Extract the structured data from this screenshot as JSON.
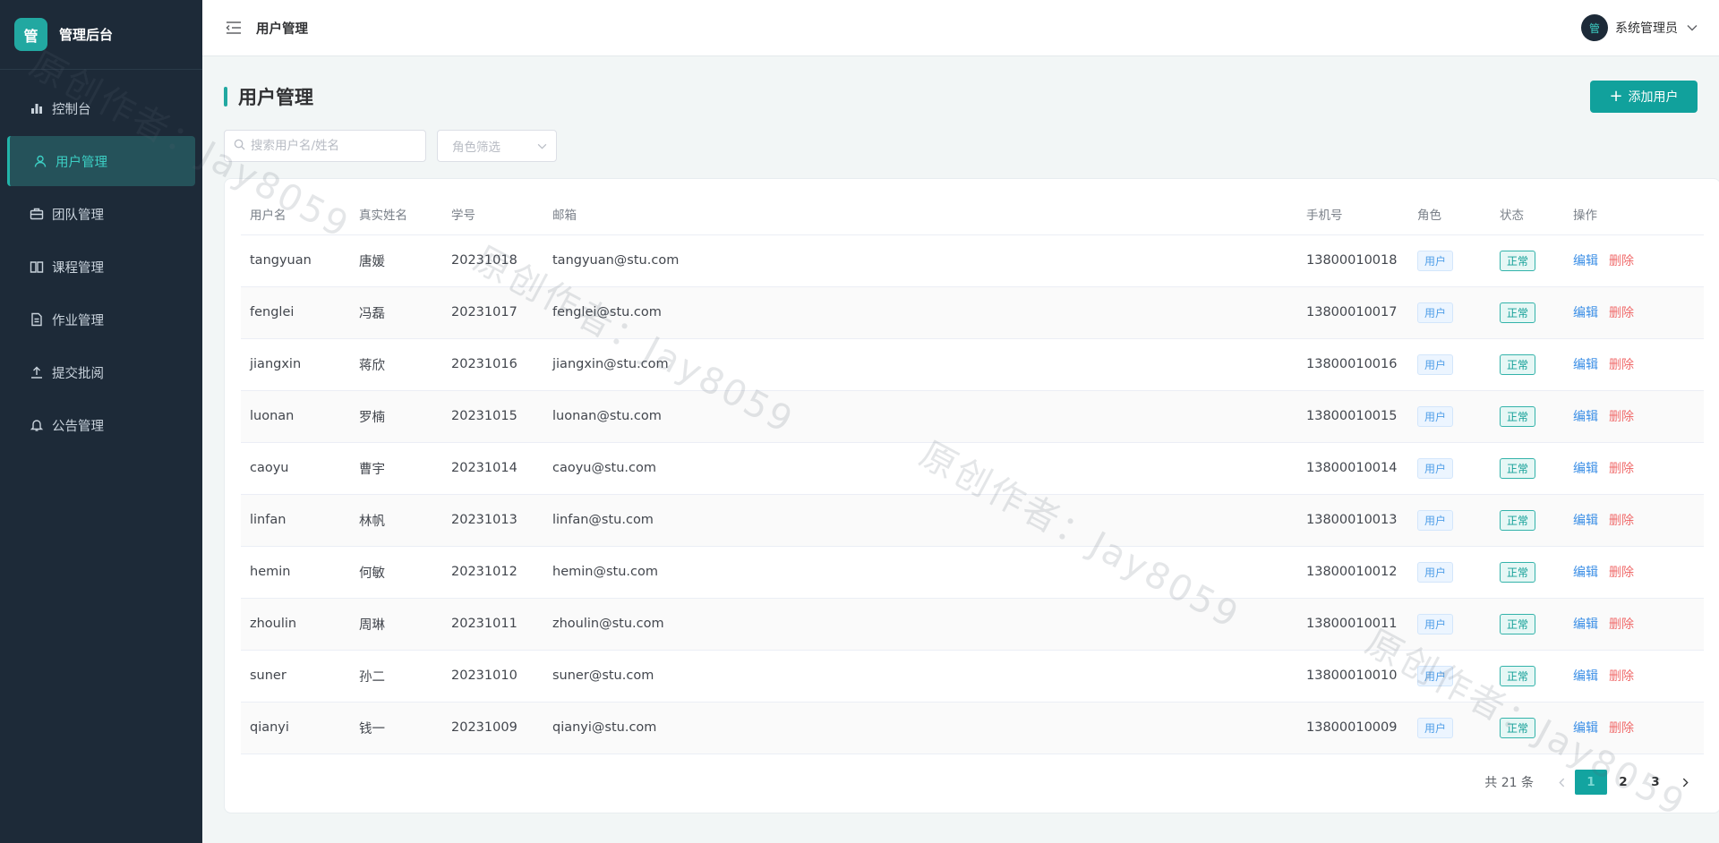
{
  "brand": {
    "logo_char": "管",
    "title": "管理后台"
  },
  "sidebar": {
    "items": [
      {
        "label": "控制台",
        "icon": "bar-chart-icon"
      },
      {
        "label": "用户管理",
        "icon": "user-icon",
        "active": true
      },
      {
        "label": "团队管理",
        "icon": "briefcase-icon"
      },
      {
        "label": "课程管理",
        "icon": "book-icon"
      },
      {
        "label": "作业管理",
        "icon": "document-icon"
      },
      {
        "label": "提交批阅",
        "icon": "upload-icon"
      },
      {
        "label": "公告管理",
        "icon": "bell-icon"
      }
    ]
  },
  "topbar": {
    "title": "用户管理",
    "avatar_char": "管",
    "user_name": "系统管理员"
  },
  "page": {
    "title": "用户管理",
    "add_button": "添加用户"
  },
  "filters": {
    "search_placeholder": "搜索用户名/姓名",
    "role_placeholder": "角色筛选"
  },
  "table": {
    "headers": {
      "username": "用户名",
      "realname": "真实姓名",
      "student_id": "学号",
      "email": "邮箱",
      "phone": "手机号",
      "role": "角色",
      "status": "状态",
      "actions": "操作"
    },
    "edit_label": "编辑",
    "delete_label": "删除",
    "rows": [
      {
        "username": "tangyuan",
        "realname": "唐媛",
        "student_id": "20231018",
        "email": "tangyuan@stu.com",
        "phone": "13800010018",
        "role": "用户",
        "status": "正常"
      },
      {
        "username": "fenglei",
        "realname": "冯磊",
        "student_id": "20231017",
        "email": "fenglei@stu.com",
        "phone": "13800010017",
        "role": "用户",
        "status": "正常"
      },
      {
        "username": "jiangxin",
        "realname": "蒋欣",
        "student_id": "20231016",
        "email": "jiangxin@stu.com",
        "phone": "13800010016",
        "role": "用户",
        "status": "正常"
      },
      {
        "username": "luonan",
        "realname": "罗楠",
        "student_id": "20231015",
        "email": "luonan@stu.com",
        "phone": "13800010015",
        "role": "用户",
        "status": "正常"
      },
      {
        "username": "caoyu",
        "realname": "曹宇",
        "student_id": "20231014",
        "email": "caoyu@stu.com",
        "phone": "13800010014",
        "role": "用户",
        "status": "正常"
      },
      {
        "username": "linfan",
        "realname": "林帆",
        "student_id": "20231013",
        "email": "linfan@stu.com",
        "phone": "13800010013",
        "role": "用户",
        "status": "正常"
      },
      {
        "username": "hemin",
        "realname": "何敏",
        "student_id": "20231012",
        "email": "hemin@stu.com",
        "phone": "13800010012",
        "role": "用户",
        "status": "正常"
      },
      {
        "username": "zhoulin",
        "realname": "周琳",
        "student_id": "20231011",
        "email": "zhoulin@stu.com",
        "phone": "13800010011",
        "role": "用户",
        "status": "正常"
      },
      {
        "username": "suner",
        "realname": "孙二",
        "student_id": "20231010",
        "email": "suner@stu.com",
        "phone": "13800010010",
        "role": "用户",
        "status": "正常"
      },
      {
        "username": "qianyi",
        "realname": "钱一",
        "student_id": "20231009",
        "email": "qianyi@stu.com",
        "phone": "13800010009",
        "role": "用户",
        "status": "正常"
      }
    ]
  },
  "pagination": {
    "total_text": "共 21 条",
    "pages": [
      "1",
      "2",
      "3"
    ],
    "current": "1"
  },
  "watermark": {
    "text": "原创作者：Jay8059"
  },
  "colors": {
    "sidebar_bg": "#1d2a38",
    "accent": "#11a19c",
    "edit_link": "#3a8ee6",
    "delete_link": "#f06c6c"
  }
}
